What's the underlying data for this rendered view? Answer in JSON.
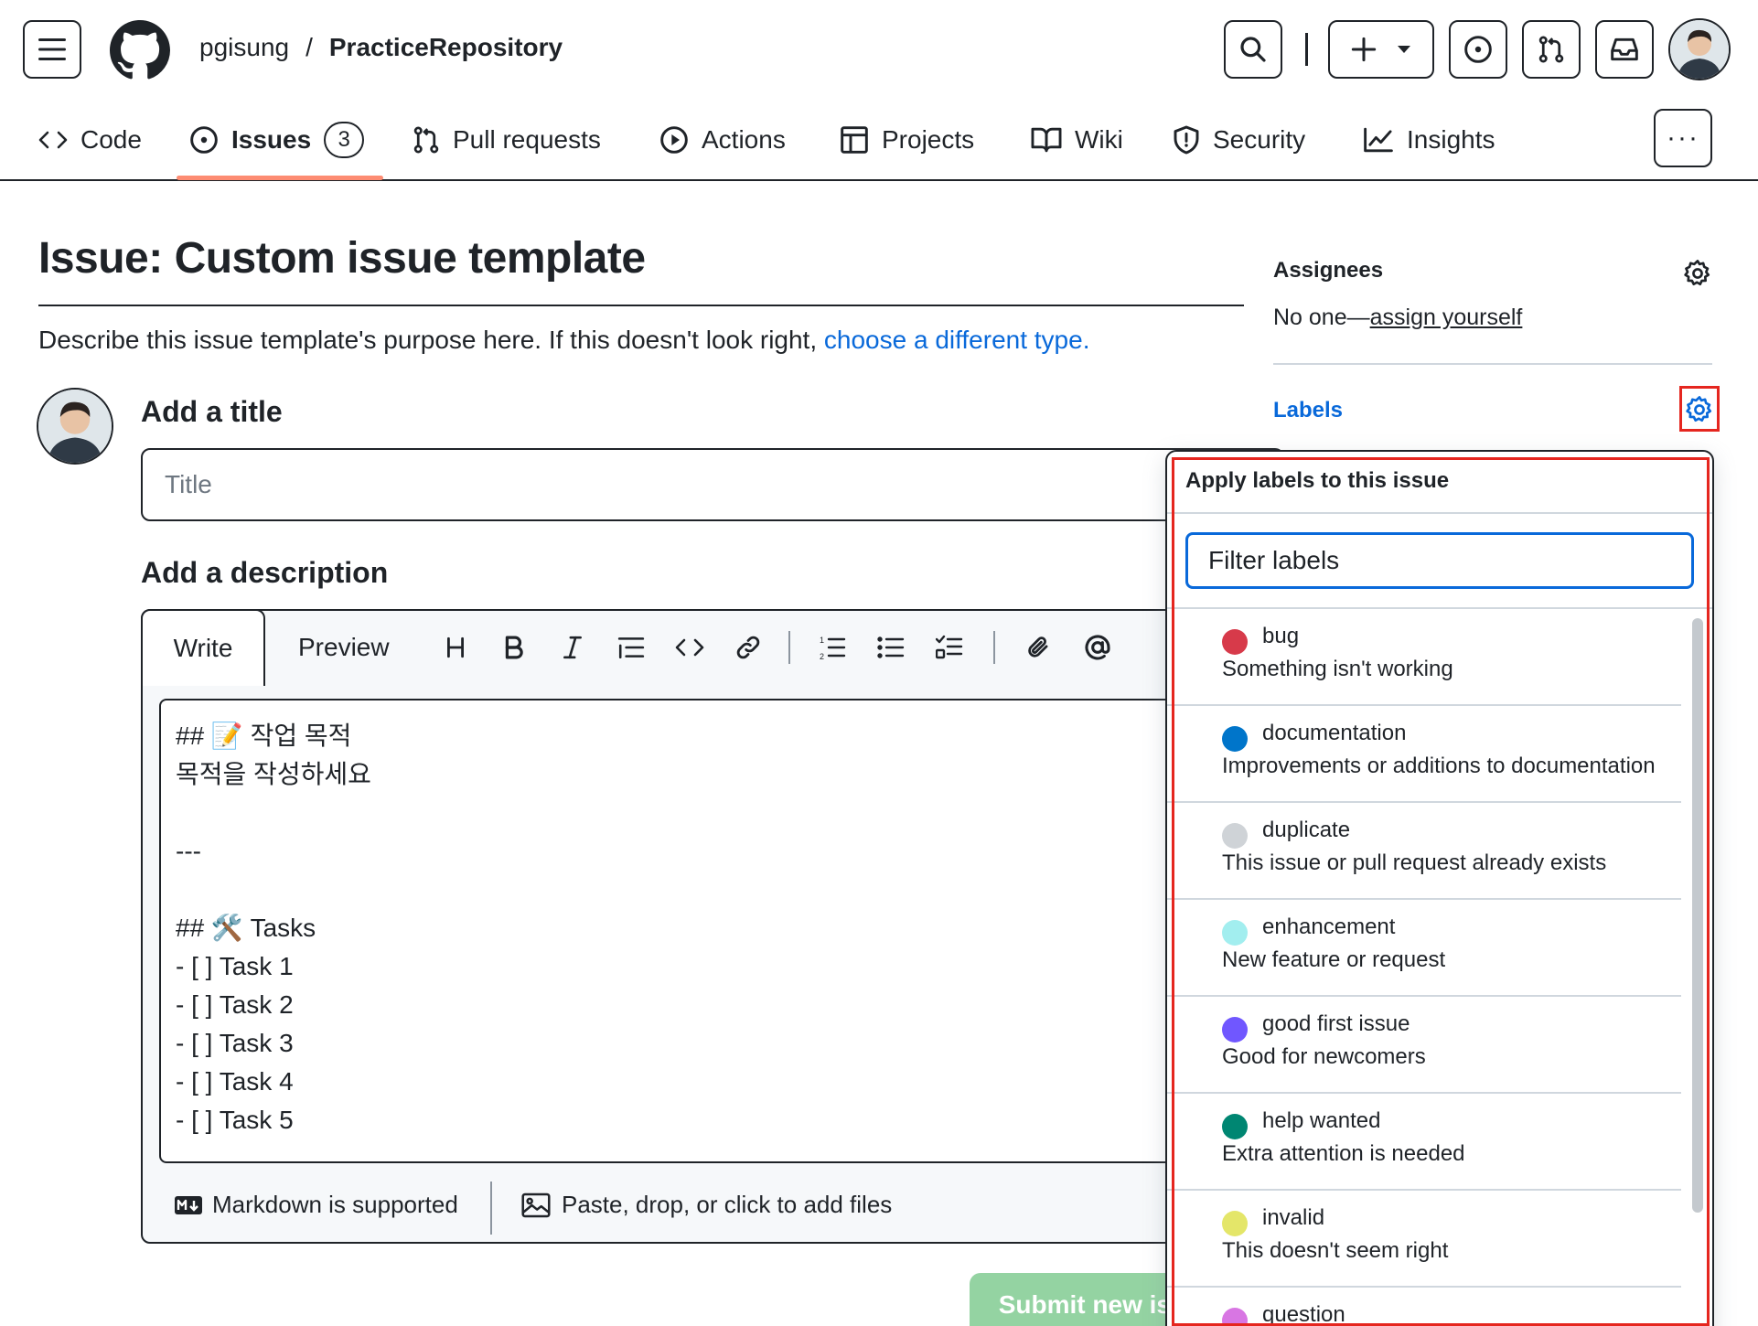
{
  "header": {
    "owner": "pgisung",
    "separator": "/",
    "repo": "PracticeRepository"
  },
  "nav": {
    "items": [
      {
        "label": "Code",
        "icon": "code-icon"
      },
      {
        "label": "Issues",
        "icon": "issue-opened-icon",
        "count": "3",
        "active": true
      },
      {
        "label": "Pull requests",
        "icon": "git-pull-request-icon"
      },
      {
        "label": "Actions",
        "icon": "play-icon"
      },
      {
        "label": "Projects",
        "icon": "table-icon"
      },
      {
        "label": "Wiki",
        "icon": "book-icon"
      },
      {
        "label": "Security",
        "icon": "shield-icon"
      },
      {
        "label": "Insights",
        "icon": "graph-icon"
      }
    ],
    "more": "···"
  },
  "page": {
    "title": "Issue: Custom issue template",
    "describe_text": "Describe this issue template's purpose here. If this doesn't look right, ",
    "describe_link": "choose a different type."
  },
  "form": {
    "add_title_heading": "Add a title",
    "title_placeholder": "Title",
    "add_description_heading": "Add a description",
    "tab_write": "Write",
    "tab_preview": "Preview",
    "toolbar": [
      "heading-icon",
      "bold-icon",
      "italic-icon",
      "quote-icon",
      "code-icon",
      "link-icon",
      "ordered-list-icon",
      "unordered-list-icon",
      "task-list-icon",
      "paperclip-icon",
      "mention-icon"
    ],
    "body_text": "## 📝 작업 목적\n목적을 작성하세요\n\n---\n\n## 🛠️ Tasks\n- [ ] Task 1\n- [ ] Task 2\n- [ ] Task 3\n- [ ] Task 4\n- [ ] Task 5",
    "markdown_note": "Markdown is supported",
    "attach_note": "Paste, drop, or click to add files",
    "submit_label": "Submit new issue"
  },
  "sidebar": {
    "assignees_heading": "Assignees",
    "assignees_prefix": "No one—",
    "assignees_link": "assign yourself",
    "labels_heading": "Labels"
  },
  "label_popover": {
    "title": "Apply labels to this issue",
    "filter_placeholder": "Filter labels",
    "labels": [
      {
        "name": "bug",
        "description": "Something isn't working",
        "color": "#d73a4a"
      },
      {
        "name": "documentation",
        "description": "Improvements or additions to documentation",
        "color": "#0075ca"
      },
      {
        "name": "duplicate",
        "description": "This issue or pull request already exists",
        "color": "#cfd3d7"
      },
      {
        "name": "enhancement",
        "description": "New feature or request",
        "color": "#a2eeef"
      },
      {
        "name": "good first issue",
        "description": "Good for newcomers",
        "color": "#7057ff"
      },
      {
        "name": "help wanted",
        "description": "Extra attention is needed",
        "color": "#008672"
      },
      {
        "name": "invalid",
        "description": "This doesn't seem right",
        "color": "#e4e669"
      },
      {
        "name": "question",
        "description": "",
        "color": "#d876e3"
      }
    ]
  },
  "colors": {
    "link": "#0969da",
    "highlight": "#e5261f",
    "submit": "#94d3a2",
    "active_tab_underline": "#fd8c73"
  }
}
